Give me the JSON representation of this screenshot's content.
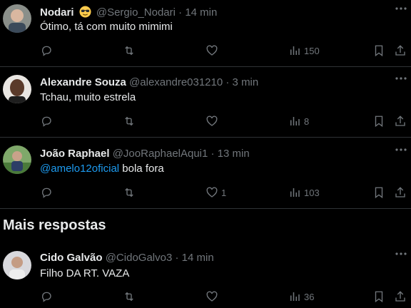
{
  "posts": [
    {
      "name": "Nodari",
      "emoji": "sunglasses-emoji",
      "handle": "@Sergio_Nodari",
      "time": "· 14 min",
      "text": "Ótimo, tá com muito mimimi",
      "mention": "",
      "likes": "",
      "views": "150"
    },
    {
      "name": "Alexandre Souza",
      "handle": "@alexandre031210",
      "time": "· 3 min",
      "text": "Tchau, muito estrela",
      "mention": "",
      "likes": "",
      "views": "8"
    },
    {
      "name": "João Raphael",
      "handle": "@JooRaphaelAqui1",
      "time": "· 13 min",
      "mention": "@amelo12oficial",
      "text": " bola fora",
      "likes": "1",
      "views": "103"
    },
    {
      "name": "Cido Galvão",
      "handle": "@CidoGalvo3",
      "time": "· 14 min",
      "text": "Filho DA RT. VAZA",
      "mention": "",
      "likes": "",
      "views": "36"
    }
  ],
  "section": {
    "title": "Mais respostas"
  },
  "colors": {
    "background": "#000000",
    "text": "#e7e9ea",
    "muted": "#71767b",
    "link": "#1d9bf0",
    "border": "#2f3336"
  }
}
